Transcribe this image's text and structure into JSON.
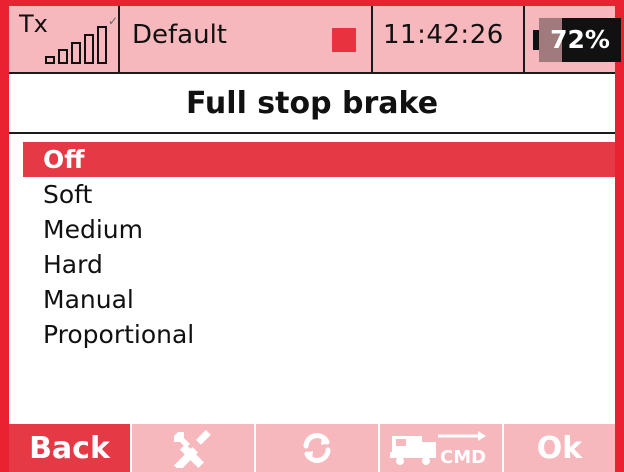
{
  "status_bar": {
    "tx_label": "Tx",
    "signal_bars": 5,
    "model_name": "Default",
    "time": "11:42:26",
    "battery_percent": "72%",
    "battery_level": 0.28,
    "record_color": "#e8323f"
  },
  "screen": {
    "title": "Full stop brake"
  },
  "options": [
    {
      "label": "Off",
      "selected": true
    },
    {
      "label": "Soft",
      "selected": false
    },
    {
      "label": "Medium",
      "selected": false
    },
    {
      "label": "Hard",
      "selected": false
    },
    {
      "label": "Manual",
      "selected": false
    },
    {
      "label": "Proportional",
      "selected": false
    }
  ],
  "toolbar": {
    "back_label": "Back",
    "tools_icon": "wrench-screwdriver-icon",
    "sync_icon": "refresh-icon",
    "cmd_icon": "vehicle-cmd-icon",
    "cmd_label": "CMD",
    "ok_label": "Ok"
  },
  "colors": {
    "accent": "#e63946",
    "frame": "#ea2130",
    "panel": "#f7b8bd"
  }
}
